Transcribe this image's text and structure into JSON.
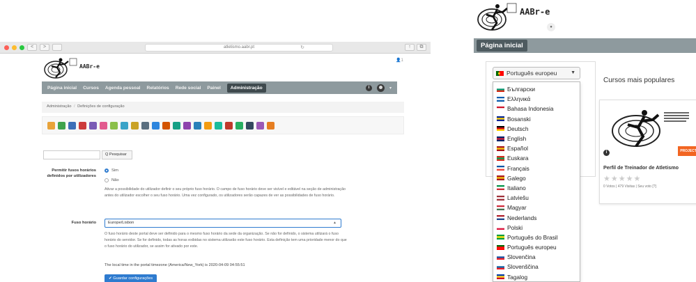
{
  "browser": {
    "url": "atletismo.aabr.pt",
    "window_buttons": [
      "<",
      ">"
    ]
  },
  "site": {
    "brand": "AABr-e",
    "user_notification": "1",
    "nav": {
      "items": [
        "Página inicial",
        "Cursos",
        "Agenda pessoal",
        "Relatórios",
        "Rede social",
        "Painel"
      ],
      "active": "Administração",
      "info_icon": "i",
      "user_caret": "▾"
    },
    "breadcrumb": {
      "items": [
        "Administração",
        "Definições de configuração"
      ],
      "separator": "/"
    },
    "toolbar_icons": [
      "#e8a33a",
      "#3fa34d",
      "#3d6fb8",
      "#cc3b3b",
      "#7a5bb5",
      "#e25a8e",
      "#8bbf4a",
      "#3aa3c8",
      "#c9a227",
      "#5a6f7f",
      "#2e86de",
      "#d35400",
      "#16a085",
      "#8e44ad",
      "#2980b9",
      "#f39c12",
      "#1abc9c",
      "#c0392b",
      "#27ae60",
      "#34495e",
      "#9b59b6",
      "#e67e22"
    ],
    "search": {
      "placeholder": "",
      "button": "Q Pesquisar"
    },
    "settings": {
      "user_timezone_label": "Permitir fusos horários definidos por utilizadores",
      "radio_yes": "Sim",
      "radio_no": "Não",
      "user_timezone_desc": "Ativar a possibilidade do utilizador definir o seu próprio fuso horário. O campo de fuso horário deve ser visível e editável na seção de administração antes do utilizador escolher o seu fuso horário. Uma vez configurado, os utilizadores serão capazes de ver as possibilidades de fuso horário.",
      "timezone_label": "Fuso horário",
      "timezone_value": "Europe/Lisbon",
      "timezone_desc": "O fuso horário deste portal deve ser definido para o mesmo fuso horário da sede da organização. Se não for definido, o sistema utilizará o fuso horário do servidor. Se for definido, todas as horas exibidas no sistema utilizarão este fuso horário. Esta definição tem uma prioridade menor do que o fuso horário do utilizador, se assim for ativado por este.",
      "local_time": "The local time in the portal timezone (America/New_York) is 2020-04-09 04:55:51",
      "save_button": "✔ Guardar configurações"
    }
  },
  "zoom": {
    "brand": "AABr-e",
    "home_button": "Página inicial",
    "language_selected": "Português europeu",
    "languages": [
      {
        "label": "Български",
        "flag": [
          "#ffffff",
          "#00966e",
          "#d62612"
        ]
      },
      {
        "label": "Ελληνικά",
        "flag": [
          "#0d5eaf",
          "#ffffff",
          "#0d5eaf"
        ]
      },
      {
        "label": "Bahasa Indonesia",
        "flag": [
          "#ce1126",
          "#ffffff",
          "#ffffff"
        ]
      },
      {
        "label": "Bosanski",
        "flag": [
          "#002395",
          "#fecb00",
          "#002395"
        ]
      },
      {
        "label": "Deutsch",
        "flag": [
          "#000000",
          "#dd0000",
          "#ffce00"
        ]
      },
      {
        "label": "English",
        "flag": [
          "#012169",
          "#c8102e",
          "#012169"
        ]
      },
      {
        "label": "Español",
        "flag": [
          "#aa151b",
          "#f1bf00",
          "#aa151b"
        ]
      },
      {
        "label": "Euskara",
        "flag": [
          "#d52b1e",
          "#009b48",
          "#d52b1e"
        ]
      },
      {
        "label": "Français",
        "flag": [
          "#0055a4",
          "#ffffff",
          "#ef4135"
        ]
      },
      {
        "label": "Galego",
        "flag": [
          "#aa151b",
          "#f1bf00",
          "#aa151b"
        ]
      },
      {
        "label": "Italiano",
        "flag": [
          "#009246",
          "#ffffff",
          "#ce2b37"
        ]
      },
      {
        "label": "Latviešu",
        "flag": [
          "#9e3039",
          "#ffffff",
          "#9e3039"
        ]
      },
      {
        "label": "Magyar",
        "flag": [
          "#ce2939",
          "#ffffff",
          "#477050"
        ]
      },
      {
        "label": "Nederlands",
        "flag": [
          "#ae1c28",
          "#ffffff",
          "#21468b"
        ]
      },
      {
        "label": "Polski",
        "flag": [
          "#ffffff",
          "#ffffff",
          "#dc143c"
        ]
      },
      {
        "label": "Português do Brasil",
        "flag": [
          "#009c3b",
          "#ffdf00",
          "#009c3b"
        ]
      },
      {
        "label": "Português europeu",
        "flag": [
          "#006600",
          "#ff0000",
          "#ff0000"
        ]
      },
      {
        "label": "Slovenčina",
        "flag": [
          "#ffffff",
          "#0b4ea2",
          "#ee1c25"
        ]
      },
      {
        "label": "Slovenščina",
        "flag": [
          "#ffffff",
          "#005da4",
          "#ed1c24"
        ]
      },
      {
        "label": "Tagalog",
        "flag": [
          "#0038a8",
          "#fcd116",
          "#ce1126"
        ]
      }
    ],
    "popular_title": "Cursos mais populares",
    "course": {
      "tag": "PROJECT",
      "info_icon": "i",
      "title": "Perfil de Treinador de Atletismo",
      "stars": "★★★★★",
      "stats": "0 Votos | 479 Visitas | Seu voto [?]"
    }
  }
}
